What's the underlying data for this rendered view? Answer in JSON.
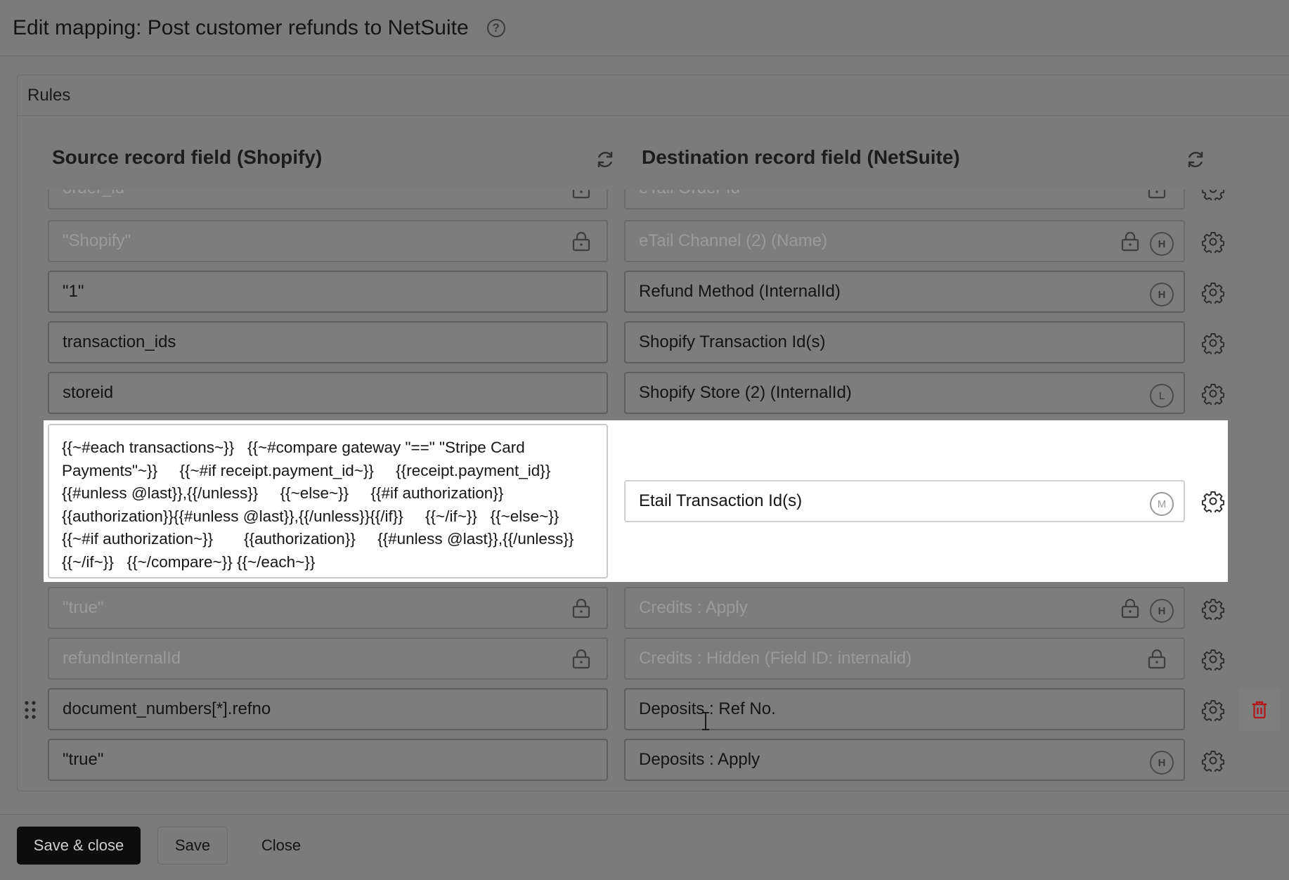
{
  "header": {
    "title": "Edit mapping: Post customer refunds to NetSuite",
    "help_icon": "question-circle-icon"
  },
  "rules": {
    "title": "Rules",
    "source_header": "Source record field (Shopify)",
    "destination_header": "Destination record field (NetSuite)",
    "rows": [
      {
        "source": "order_id",
        "source_locked": true,
        "destination": "eTail Order Id",
        "destination_locked": true,
        "badge": "",
        "dim": true
      },
      {
        "source": "\"Shopify\"",
        "source_locked": true,
        "destination": "eTail Channel (2) (Name)",
        "destination_locked": true,
        "badge": "H",
        "dim": true
      },
      {
        "source": "\"1\"",
        "source_locked": false,
        "destination": "Refund Method (InternalId)",
        "destination_locked": false,
        "badge": "H",
        "dim": false
      },
      {
        "source": "transaction_ids",
        "source_locked": false,
        "destination": "Shopify Transaction Id(s)",
        "destination_locked": false,
        "badge": "",
        "dim": false
      },
      {
        "source": "storeid",
        "source_locked": false,
        "destination": "Shopify Store (2) (InternalId)",
        "destination_locked": false,
        "badge": "L",
        "dim": false
      },
      {
        "source": "{{~#each transactions~}}   {{~#compare gateway \"==\" \"Stripe Card Payments\"~}}     {{~#if receipt.payment_id~}}     {{receipt.payment_id}}{{#unless @last}},{{/unless}}     {{~else~}}     {{#if authorization}}{{authorization}}{{#unless @last}},{{/unless}}{{/if}}     {{~/if~}}   {{~else~}}     {{~#if authorization~}}       {{authorization}}     {{#unless @last}},{{/unless}}     {{~/if~}}   {{~/compare~}} {{~/each~}}",
        "source_locked": false,
        "destination": "Etail Transaction Id(s)",
        "destination_locked": false,
        "badge": "M",
        "dim": false
      },
      {
        "source": "\"true\"",
        "source_locked": true,
        "destination": "Credits : Apply",
        "destination_locked": true,
        "badge": "H",
        "dim": true
      },
      {
        "source": "refundInternalId",
        "source_locked": true,
        "destination": "Credits : Hidden (Field ID: internalid)",
        "destination_locked": true,
        "badge": "",
        "dim": true
      },
      {
        "source": "document_numbers[*].refno",
        "source_locked": false,
        "destination": "Deposits : Ref No.",
        "destination_locked": false,
        "badge": "",
        "dim": false
      },
      {
        "source": "\"true\"",
        "source_locked": false,
        "destination": "Deposits : Apply",
        "destination_locked": false,
        "badge": "H",
        "dim": false
      }
    ]
  },
  "footer": {
    "save_close": "Save & close",
    "save": "Save",
    "close": "Close"
  },
  "colors": {
    "overlay": "#7b7b7b",
    "highlight": "#ffffff",
    "primary_button": "#0d0d0d",
    "delete": "#b3151b"
  }
}
